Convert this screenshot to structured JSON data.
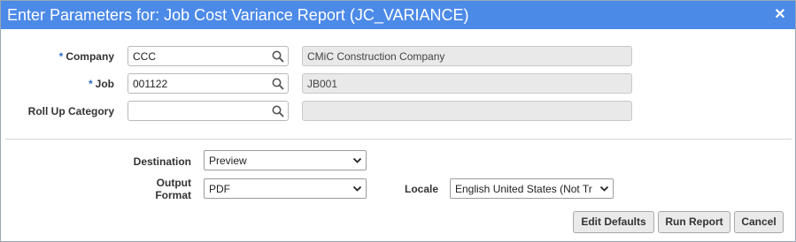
{
  "dialog": {
    "title": "Enter Parameters for: Job Cost Variance Report (JC_VARIANCE)",
    "close_glyph": "✕"
  },
  "params": {
    "company": {
      "required_mark": "*",
      "label": "Company",
      "value": "CCC",
      "description": "CMiC Construction Company"
    },
    "job": {
      "required_mark": "*",
      "label": "Job",
      "value": "001122",
      "description": "JB001"
    },
    "roll_up": {
      "label": "Roll Up Category",
      "value": "",
      "description": ""
    }
  },
  "output": {
    "destination": {
      "label": "Destination",
      "value": "Preview"
    },
    "format": {
      "label_line1": "Output",
      "label_line2": "Format",
      "value": "PDF"
    },
    "locale": {
      "label": "Locale",
      "value": "English United States (Not Tr"
    }
  },
  "buttons": {
    "edit_defaults": "Edit Defaults",
    "run_report": "Run Report",
    "cancel": "Cancel"
  },
  "colors": {
    "titlebar": "#4c8ae8",
    "required_mark": "#2a6cc8"
  },
  "icons": {
    "search": "search-icon",
    "dropdown": "chevron-down-icon",
    "close": "close-icon"
  }
}
